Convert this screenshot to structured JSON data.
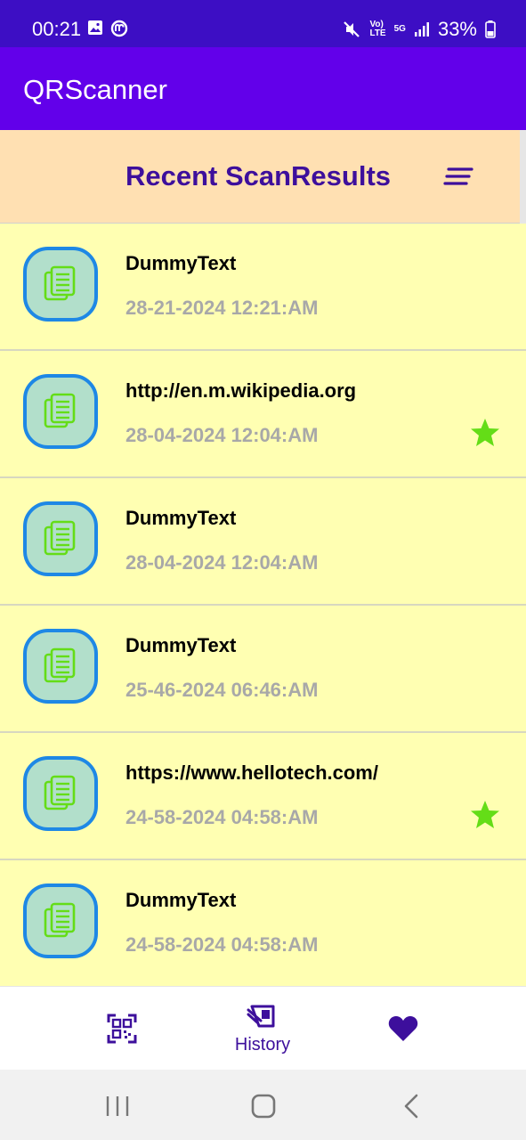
{
  "status_bar": {
    "time": "00:21",
    "battery": "33%",
    "network": "5G",
    "volte": "VoLTE"
  },
  "app_bar": {
    "title": "QRScanner"
  },
  "section": {
    "title": "Recent ScanResults",
    "sort_icon": "sort-icon"
  },
  "items": [
    {
      "title": "DummyText",
      "date": "28-21-2024 12:21:AM",
      "favorite": false
    },
    {
      "title": "http://en.m.wikipedia.org",
      "date": "28-04-2024 12:04:AM",
      "favorite": true
    },
    {
      "title": "DummyText",
      "date": "28-04-2024 12:04:AM",
      "favorite": false
    },
    {
      "title": "DummyText",
      "date": "25-46-2024 06:46:AM",
      "favorite": false
    },
    {
      "title": "https://www.hellotech.com/",
      "date": "24-58-2024 04:58:AM",
      "favorite": true
    },
    {
      "title": "DummyText",
      "date": "24-58-2024 04:58:AM",
      "favorite": false
    }
  ],
  "bottom_nav": {
    "scan_icon": "qr-code-icon",
    "history_label": "History",
    "history_icon": "history-icon",
    "favorites_icon": "heart-icon"
  },
  "colors": {
    "status_bar": "#3d0ec4",
    "app_bar": "#6200ea",
    "header_bg": "#ffe0b2",
    "row_bg": "#ffffb2",
    "accent": "#3d0f9c",
    "icon_border": "#1e88e5",
    "icon_fill": "#b2dfcb",
    "star": "#64dd17"
  }
}
